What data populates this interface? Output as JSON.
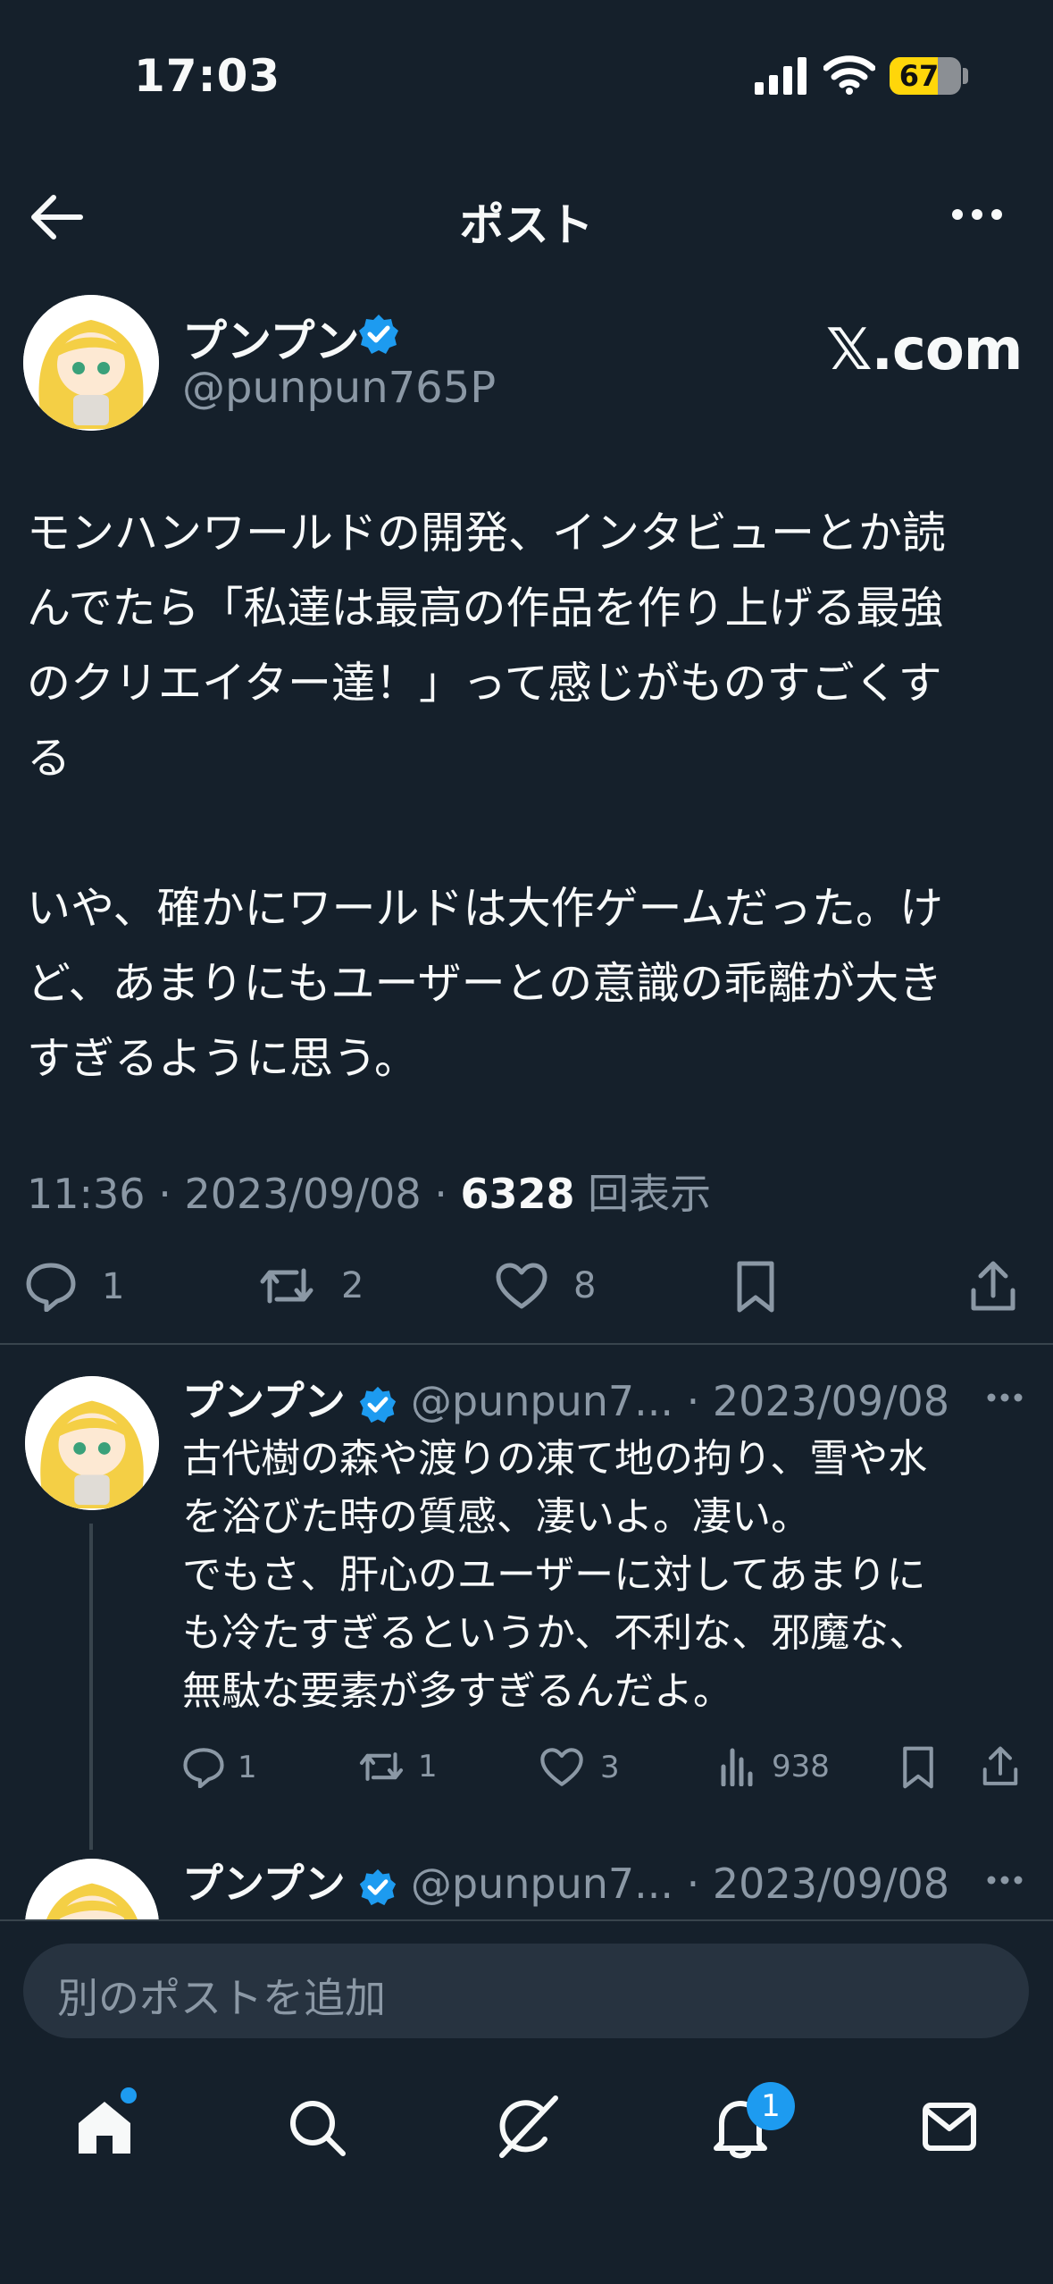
{
  "status_bar": {
    "time": "17:03",
    "battery": "67",
    "battery_level": 0.67
  },
  "header": {
    "title": "ポスト"
  },
  "post": {
    "author_name": "プンプン",
    "author_handle": "@punpun765P",
    "card_label": "𝕏.com",
    "text": "モンハンワールドの開発、インタビューとか読\nんでたら「私達は最高の作品を作り上げる最強\nのクリエイター達！」って感じがものすごくす\nる\n\nいや、確かにワールドは大作ゲームだった。け\nど、あまりにもユーザーとの意識の乖離が大き\nすぎるように思う。",
    "time": "11:36",
    "date": "2023/09/08",
    "views": "6328",
    "views_label": "回表示",
    "replies": "1",
    "reposts": "2",
    "likes": "8"
  },
  "reply1": {
    "author_name": "プンプン",
    "author_handle": "@punpun7...",
    "date": "2023/09/08",
    "text": "古代樹の森や渡りの凍て地の拘り、雪や水\nを浴びた時の質感、凄いよ。凄い。\nでもさ、肝心のユーザーに対してあまりに\nも冷たすぎるというか、不利な、邪魔な、\n無駄な要素が多すぎるんだよ。",
    "replies": "1",
    "reposts": "1",
    "likes": "3",
    "views": "938"
  },
  "reply2": {
    "author_name": "プンプン",
    "author_handle": "@punpun7...",
    "date": "2023/09/08"
  },
  "composer": {
    "placeholder": "別のポストを追加"
  },
  "tabbar": {
    "notification_count": "1"
  },
  "colors": {
    "background": "#15202b",
    "accent": "#1d9bf0",
    "muted": "#8b98a5"
  }
}
